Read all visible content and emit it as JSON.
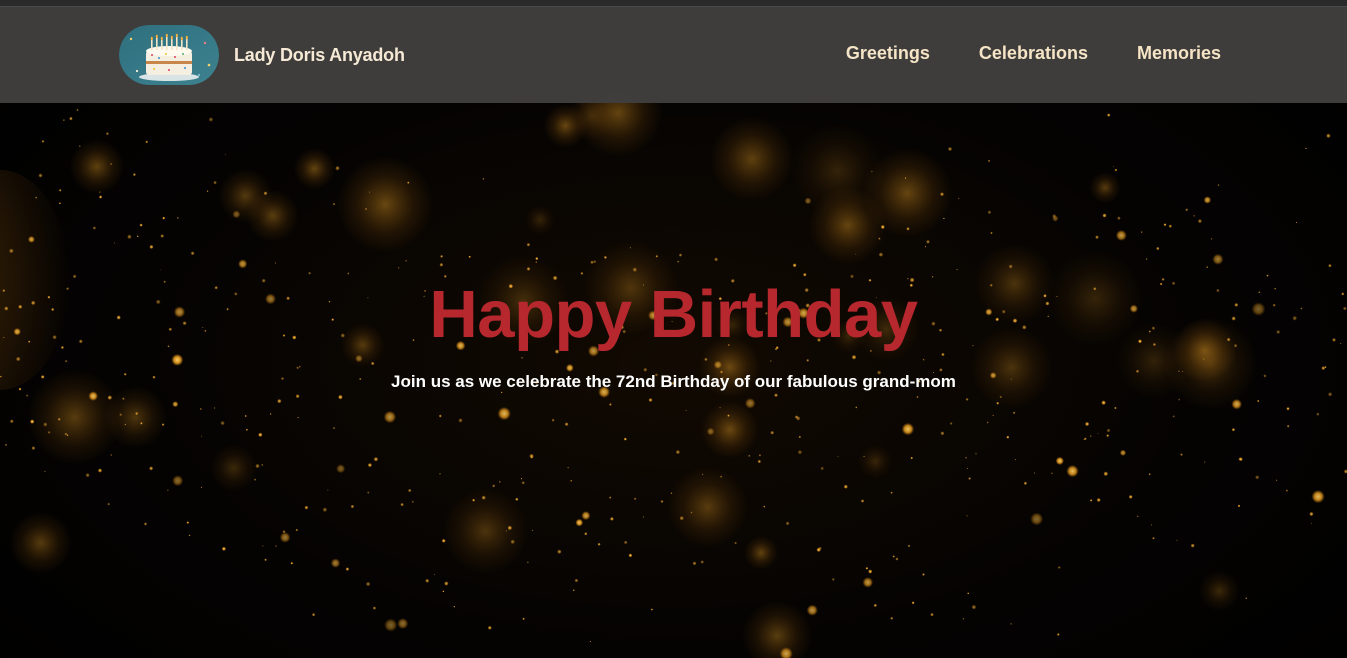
{
  "brand": {
    "name": "Lady Doris Anyadoh",
    "logo_icon": "birthday-cake-icon"
  },
  "nav": {
    "items": [
      {
        "label": "Greetings"
      },
      {
        "label": "Celebrations"
      },
      {
        "label": "Memories"
      }
    ]
  },
  "hero": {
    "title": "Happy Birthday",
    "subtitle": "Join us as we celebrate the 72nd Birthday of our fabulous grand-mom",
    "background": "gold-bokeh-sparkles"
  },
  "colors": {
    "navbar_bg": "#403f3e",
    "nav_text": "#f6e4c6",
    "title": "#b7282e",
    "subtitle": "#ffffff",
    "sparkle": "#f0b030"
  }
}
